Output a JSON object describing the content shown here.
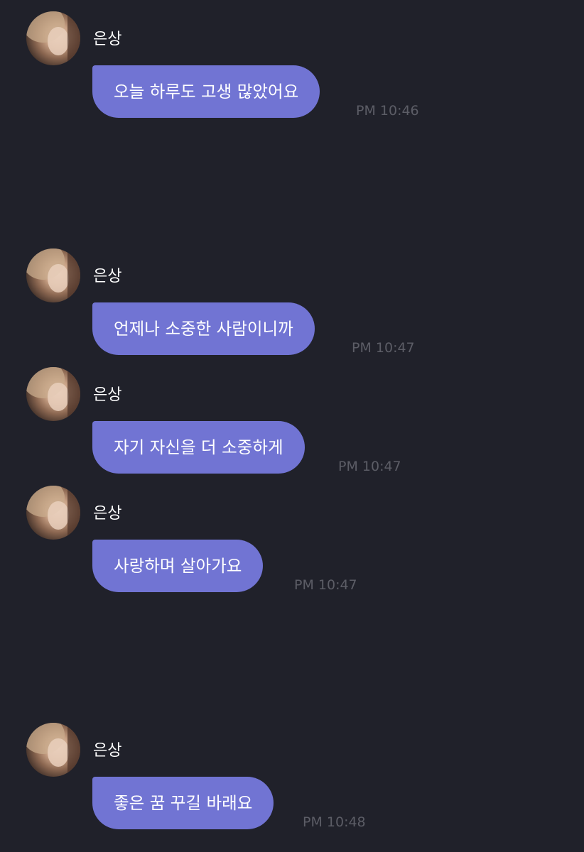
{
  "chat": {
    "messages": [
      {
        "sender": "은상",
        "text": "오늘 하루도 고생 많았어요",
        "time": "PM 10:46"
      },
      {
        "sender": "은상",
        "text": "언제나 소중한 사람이니까",
        "time": "PM 10:47"
      },
      {
        "sender": "은상",
        "text": "자기 자신을 더 소중하게",
        "time": "PM 10:47"
      },
      {
        "sender": "은상",
        "text": "사랑하며 살아가요",
        "time": "PM 10:47"
      },
      {
        "sender": "은상",
        "text": "좋은 꿈 꾸길 바래요",
        "time": "PM 10:48"
      }
    ]
  }
}
